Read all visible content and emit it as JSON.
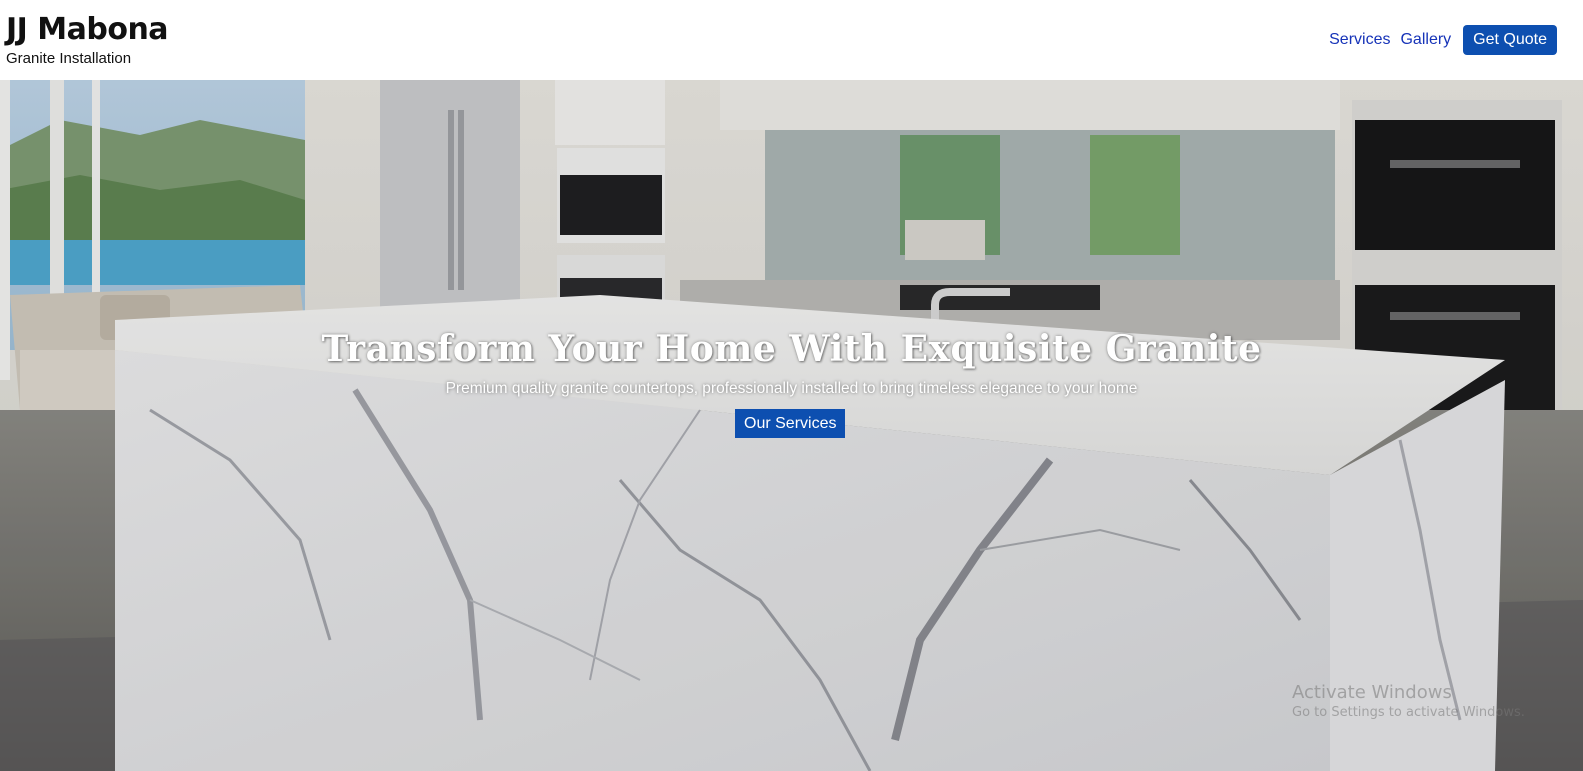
{
  "header": {
    "brand_name": "JJ Mabona",
    "brand_tagline": "Granite Installation",
    "nav": [
      {
        "label": "Services"
      },
      {
        "label": "Gallery"
      }
    ],
    "cta_label": "Get Quote"
  },
  "hero": {
    "title": "Transform Your Home With Exquisite Granite",
    "subtitle": "Premium quality granite countertops, professionally installed to bring timeless elegance to your home",
    "button_label": "Our Services",
    "image": "kitchen-marble-island-photo"
  },
  "watermark": {
    "title": "Activate Windows",
    "subtitle": "Go to Settings to activate Windows."
  },
  "colors": {
    "accent": "#0d4fb0",
    "nav_link": "#1633b8",
    "text": "#111111"
  }
}
